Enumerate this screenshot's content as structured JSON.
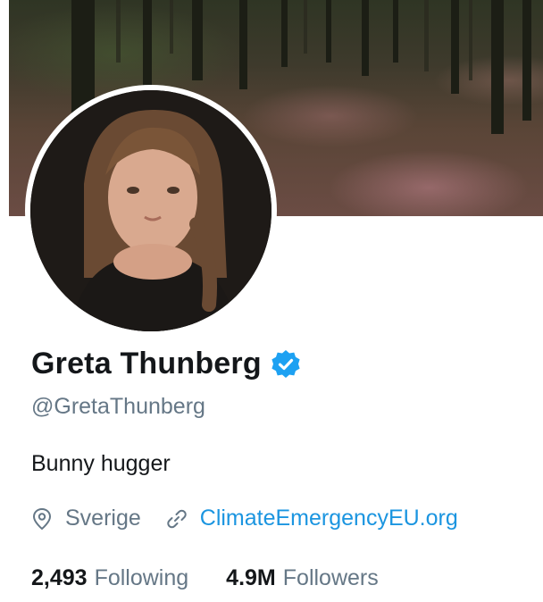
{
  "profile": {
    "name": "Greta Thunberg",
    "handle": "@GretaThunberg",
    "verified": true,
    "bio": "Bunny hugger",
    "location": "Sverige",
    "website": "ClimateEmergencyEU.org"
  },
  "stats": {
    "following_count": "2,493",
    "following_label": "Following",
    "followers_count": "4.9M",
    "followers_label": "Followers"
  },
  "icons": {
    "verified": "verified-badge-icon",
    "location": "location-pin-icon",
    "link": "link-icon"
  },
  "colors": {
    "accent": "#1da1f2",
    "link": "#1b95e0",
    "secondary_text": "#657786",
    "primary_text": "#14171a"
  }
}
